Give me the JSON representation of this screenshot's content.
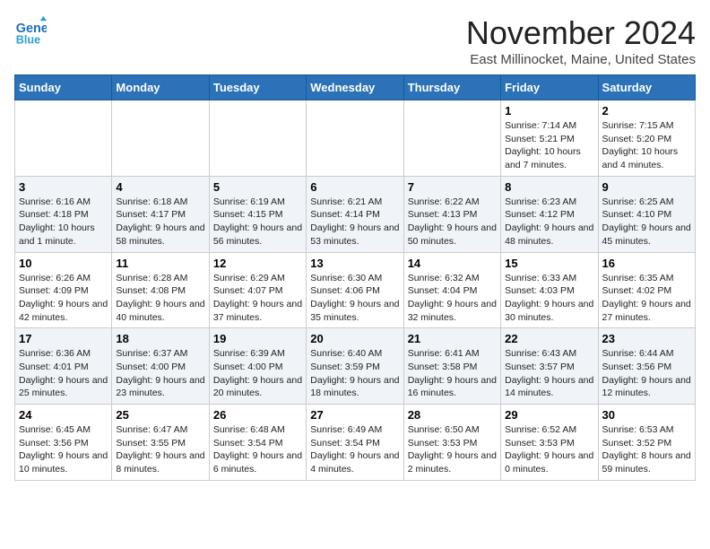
{
  "header": {
    "logo_line1": "General",
    "logo_line2": "Blue",
    "month_title": "November 2024",
    "location": "East Millinocket, Maine, United States"
  },
  "days_of_week": [
    "Sunday",
    "Monday",
    "Tuesday",
    "Wednesday",
    "Thursday",
    "Friday",
    "Saturday"
  ],
  "weeks": [
    [
      {
        "day": "",
        "info": ""
      },
      {
        "day": "",
        "info": ""
      },
      {
        "day": "",
        "info": ""
      },
      {
        "day": "",
        "info": ""
      },
      {
        "day": "",
        "info": ""
      },
      {
        "day": "1",
        "info": "Sunrise: 7:14 AM\nSunset: 5:21 PM\nDaylight: 10 hours and 7 minutes."
      },
      {
        "day": "2",
        "info": "Sunrise: 7:15 AM\nSunset: 5:20 PM\nDaylight: 10 hours and 4 minutes."
      }
    ],
    [
      {
        "day": "3",
        "info": "Sunrise: 6:16 AM\nSunset: 4:18 PM\nDaylight: 10 hours and 1 minute."
      },
      {
        "day": "4",
        "info": "Sunrise: 6:18 AM\nSunset: 4:17 PM\nDaylight: 9 hours and 58 minutes."
      },
      {
        "day": "5",
        "info": "Sunrise: 6:19 AM\nSunset: 4:15 PM\nDaylight: 9 hours and 56 minutes."
      },
      {
        "day": "6",
        "info": "Sunrise: 6:21 AM\nSunset: 4:14 PM\nDaylight: 9 hours and 53 minutes."
      },
      {
        "day": "7",
        "info": "Sunrise: 6:22 AM\nSunset: 4:13 PM\nDaylight: 9 hours and 50 minutes."
      },
      {
        "day": "8",
        "info": "Sunrise: 6:23 AM\nSunset: 4:12 PM\nDaylight: 9 hours and 48 minutes."
      },
      {
        "day": "9",
        "info": "Sunrise: 6:25 AM\nSunset: 4:10 PM\nDaylight: 9 hours and 45 minutes."
      }
    ],
    [
      {
        "day": "10",
        "info": "Sunrise: 6:26 AM\nSunset: 4:09 PM\nDaylight: 9 hours and 42 minutes."
      },
      {
        "day": "11",
        "info": "Sunrise: 6:28 AM\nSunset: 4:08 PM\nDaylight: 9 hours and 40 minutes."
      },
      {
        "day": "12",
        "info": "Sunrise: 6:29 AM\nSunset: 4:07 PM\nDaylight: 9 hours and 37 minutes."
      },
      {
        "day": "13",
        "info": "Sunrise: 6:30 AM\nSunset: 4:06 PM\nDaylight: 9 hours and 35 minutes."
      },
      {
        "day": "14",
        "info": "Sunrise: 6:32 AM\nSunset: 4:04 PM\nDaylight: 9 hours and 32 minutes."
      },
      {
        "day": "15",
        "info": "Sunrise: 6:33 AM\nSunset: 4:03 PM\nDaylight: 9 hours and 30 minutes."
      },
      {
        "day": "16",
        "info": "Sunrise: 6:35 AM\nSunset: 4:02 PM\nDaylight: 9 hours and 27 minutes."
      }
    ],
    [
      {
        "day": "17",
        "info": "Sunrise: 6:36 AM\nSunset: 4:01 PM\nDaylight: 9 hours and 25 minutes."
      },
      {
        "day": "18",
        "info": "Sunrise: 6:37 AM\nSunset: 4:00 PM\nDaylight: 9 hours and 23 minutes."
      },
      {
        "day": "19",
        "info": "Sunrise: 6:39 AM\nSunset: 4:00 PM\nDaylight: 9 hours and 20 minutes."
      },
      {
        "day": "20",
        "info": "Sunrise: 6:40 AM\nSunset: 3:59 PM\nDaylight: 9 hours and 18 minutes."
      },
      {
        "day": "21",
        "info": "Sunrise: 6:41 AM\nSunset: 3:58 PM\nDaylight: 9 hours and 16 minutes."
      },
      {
        "day": "22",
        "info": "Sunrise: 6:43 AM\nSunset: 3:57 PM\nDaylight: 9 hours and 14 minutes."
      },
      {
        "day": "23",
        "info": "Sunrise: 6:44 AM\nSunset: 3:56 PM\nDaylight: 9 hours and 12 minutes."
      }
    ],
    [
      {
        "day": "24",
        "info": "Sunrise: 6:45 AM\nSunset: 3:56 PM\nDaylight: 9 hours and 10 minutes."
      },
      {
        "day": "25",
        "info": "Sunrise: 6:47 AM\nSunset: 3:55 PM\nDaylight: 9 hours and 8 minutes."
      },
      {
        "day": "26",
        "info": "Sunrise: 6:48 AM\nSunset: 3:54 PM\nDaylight: 9 hours and 6 minutes."
      },
      {
        "day": "27",
        "info": "Sunrise: 6:49 AM\nSunset: 3:54 PM\nDaylight: 9 hours and 4 minutes."
      },
      {
        "day": "28",
        "info": "Sunrise: 6:50 AM\nSunset: 3:53 PM\nDaylight: 9 hours and 2 minutes."
      },
      {
        "day": "29",
        "info": "Sunrise: 6:52 AM\nSunset: 3:53 PM\nDaylight: 9 hours and 0 minutes."
      },
      {
        "day": "30",
        "info": "Sunrise: 6:53 AM\nSunset: 3:52 PM\nDaylight: 8 hours and 59 minutes."
      }
    ]
  ]
}
